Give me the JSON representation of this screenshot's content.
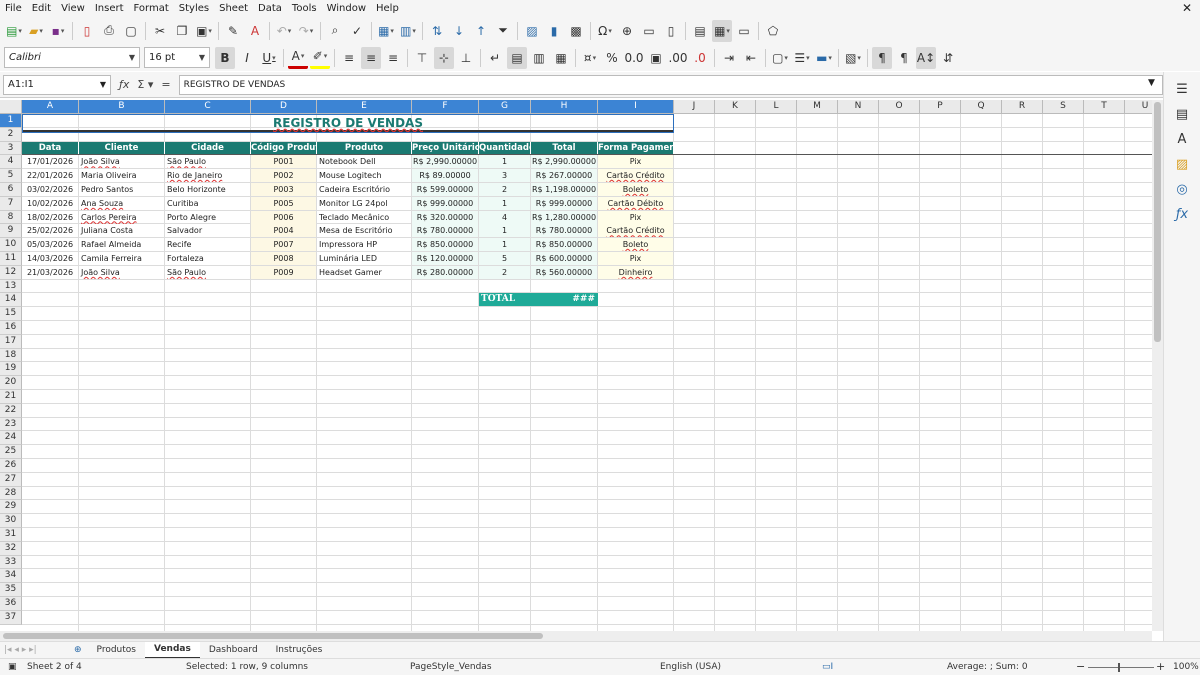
{
  "menu": [
    "File",
    "Edit",
    "View",
    "Insert",
    "Format",
    "Styles",
    "Sheet",
    "Data",
    "Tools",
    "Window",
    "Help"
  ],
  "toolbar": {
    "font_name": "Calibri",
    "font_size": "16 pt"
  },
  "formula_bar": {
    "cell_ref": "A1:I1",
    "content": "REGISTRO DE VENDAS"
  },
  "columns": [
    "A",
    "B",
    "C",
    "D",
    "E",
    "F",
    "G",
    "H",
    "I",
    "J",
    "K",
    "L",
    "M",
    "N",
    "O",
    "P",
    "Q",
    "R",
    "S",
    "T",
    "U"
  ],
  "rows": [
    "1",
    "2",
    "3",
    "4",
    "5",
    "6",
    "7",
    "8",
    "9",
    "10",
    "11",
    "12",
    "13",
    "14",
    "15",
    "16",
    "17",
    "18",
    "19",
    "20",
    "21",
    "22",
    "23",
    "24",
    "25",
    "26",
    "27",
    "28",
    "29",
    "30",
    "31",
    "32",
    "33",
    "34",
    "35",
    "36",
    "37"
  ],
  "sheet": {
    "title": "REGISTRO DE VENDAS",
    "headers": [
      "Data",
      "Cliente",
      "Cidade",
      "Código Produto",
      "Produto",
      "Preço Unitário",
      "Quantidade",
      "Total",
      "Forma Pagamento"
    ],
    "data": [
      [
        "17/01/2026",
        "João Silva",
        "São Paulo",
        "P001",
        "Notebook Dell",
        "R$ 2,990.00000",
        "1",
        "R$ 2,990.00000",
        "Pix"
      ],
      [
        "22/01/2026",
        "Maria Oliveira",
        "Rio de Janeiro",
        "P002",
        "Mouse Logitech",
        "R$ 89.00000",
        "3",
        "R$ 267.00000",
        "Cartão Crédito"
      ],
      [
        "03/02/2026",
        "Pedro Santos",
        "Belo Horizonte",
        "P003",
        "Cadeira Escritório",
        "R$ 599.00000",
        "2",
        "R$ 1,198.00000",
        "Boleto"
      ],
      [
        "10/02/2026",
        "Ana Souza",
        "Curitiba",
        "P005",
        "Monitor LG 24pol",
        "R$ 999.00000",
        "1",
        "R$ 999.00000",
        "Cartão Débito"
      ],
      [
        "18/02/2026",
        "Carlos Pereira",
        "Porto Alegre",
        "P006",
        "Teclado Mecânico",
        "R$ 320.00000",
        "4",
        "R$ 1,280.00000",
        "Pix"
      ],
      [
        "25/02/2026",
        "Juliana Costa",
        "Salvador",
        "P004",
        "Mesa de Escritório",
        "R$ 780.00000",
        "1",
        "R$ 780.00000",
        "Cartão Crédito"
      ],
      [
        "05/03/2026",
        "Rafael Almeida",
        "Recife",
        "P007",
        "Impressora HP",
        "R$ 850.00000",
        "1",
        "R$ 850.00000",
        "Boleto"
      ],
      [
        "14/03/2026",
        "Camila Ferreira",
        "Fortaleza",
        "P008",
        "Luminária LED",
        "R$ 120.00000",
        "5",
        "R$ 600.00000",
        "Pix"
      ],
      [
        "21/03/2026",
        "João Silva",
        "São Paulo",
        "P009",
        "Headset Gamer",
        "R$ 280.00000",
        "2",
        "R$ 560.00000",
        "Dinheiro"
      ]
    ],
    "total_label": "TOTAL",
    "total_value": "###"
  },
  "tabs": [
    "Produtos",
    "Vendas",
    "Dashboard",
    "Instruções"
  ],
  "active_tab": "Vendas",
  "status": {
    "sheet": "Sheet 2 of 4",
    "selection": "Selected: 1 row, 9 columns",
    "page_style": "PageStyle_Vendas",
    "language": "English (USA)",
    "aggregate": "Average: ; Sum: 0",
    "zoom": "100%"
  },
  "colors": {
    "accent": "#1b7a72",
    "total": "#1faa98",
    "selection": "#3c84d4"
  }
}
